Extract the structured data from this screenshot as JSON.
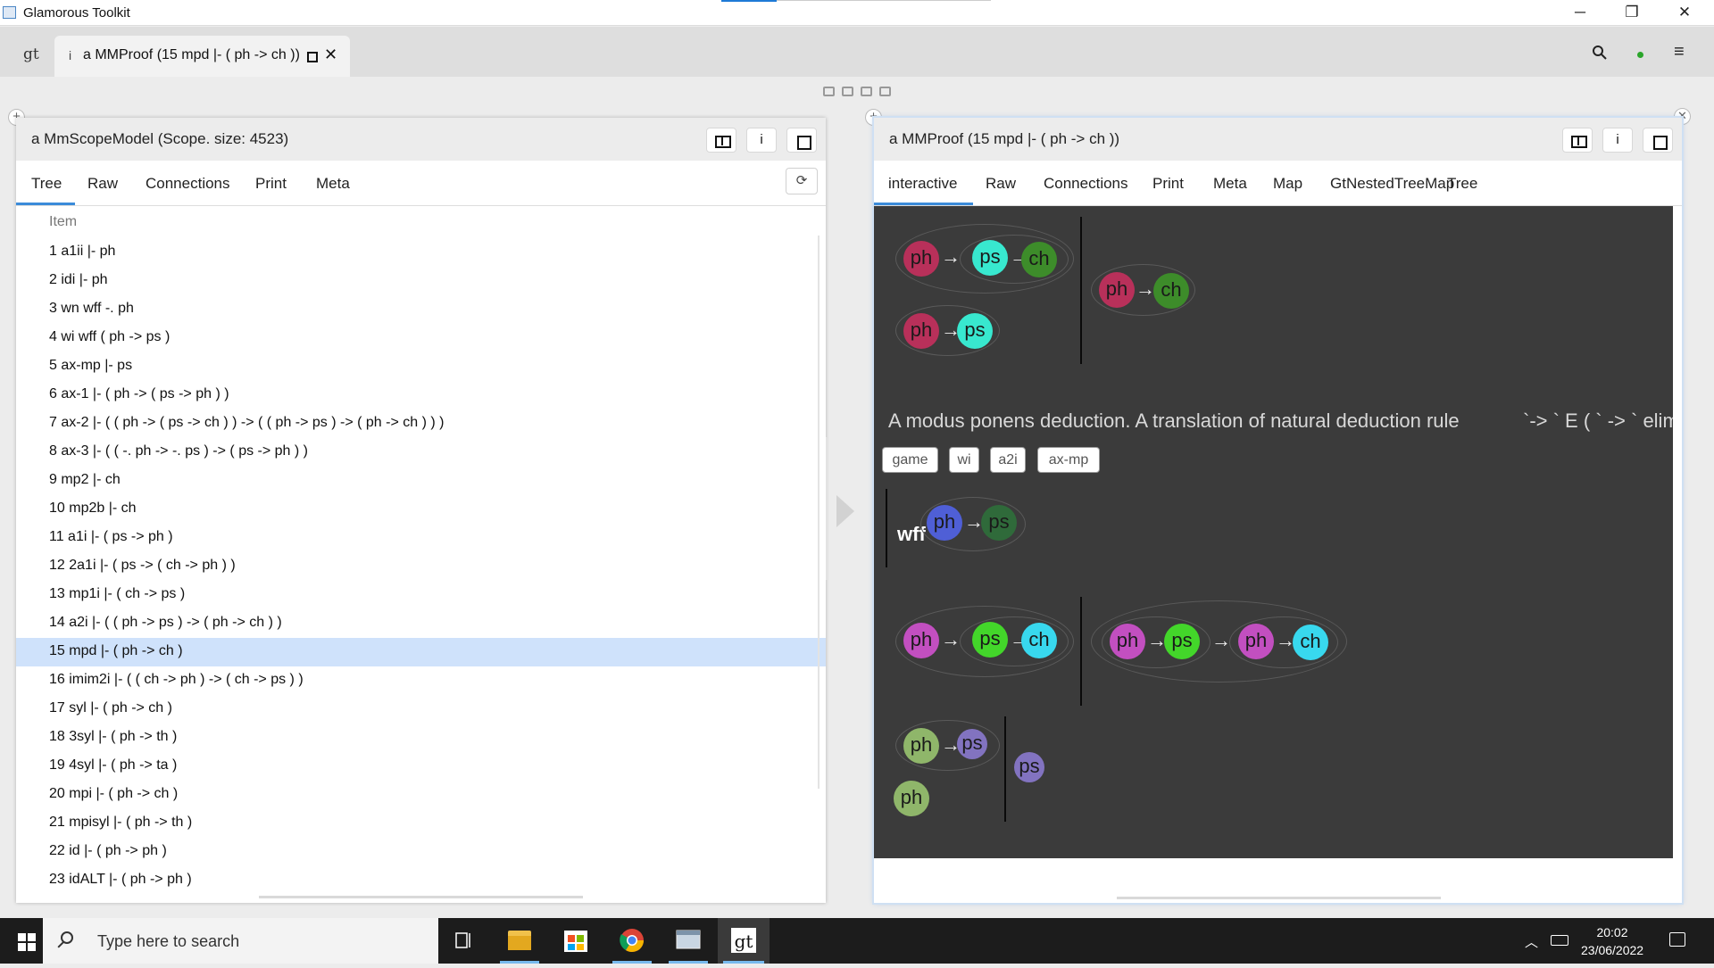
{
  "window": {
    "title": "Glamorous Toolkit",
    "minimize": "─",
    "restore": "❐",
    "close": "✕"
  },
  "tabbar": {
    "logo": "gt",
    "tab": {
      "info_icon": "i",
      "label": "a MMProof (15 mpd |- ( ph -> ch ))",
      "close": "✕"
    },
    "search_icon": "search-icon",
    "status_dot": "#2aa52a",
    "menu_icon": "≡"
  },
  "left_pane": {
    "title": "a MmScopeModel (Scope. size: 4523)",
    "buttons": {
      "inspect": "",
      "info": "i",
      "maximize": ""
    },
    "tabs": [
      "Tree",
      "Raw",
      "Connections",
      "Print",
      "Meta"
    ],
    "active_tab": "Tree",
    "refresh": "⟳",
    "column_header": "Item",
    "rows": [
      "1 a1ii |- ph",
      "2 idi |- ph",
      "3 wn wff -. ph",
      "4 wi wff ( ph -> ps )",
      "5 ax-mp |- ps",
      "6 ax-1 |- ( ph -> ( ps -> ph ) )",
      "7 ax-2 |- ( ( ph -> ( ps -> ch ) ) -> ( ( ph -> ps ) -> ( ph -> ch ) ) )",
      "8 ax-3 |- ( ( -. ph -> -. ps ) -> ( ps -> ph ) )",
      "9 mp2 |- ch",
      "10 mp2b |- ch",
      "11 a1i |- ( ps -> ph )",
      "12 2a1i |- ( ps -> ( ch -> ph ) )",
      "13 mp1i |- ( ch -> ps )",
      "14 a2i |- ( ( ph -> ps ) -> ( ph -> ch ) )",
      "15 mpd |- ( ph -> ch )",
      "16 imim2i |- ( ( ch -> ph ) -> ( ch -> ps ) )",
      "17 syl |- ( ph -> ch )",
      "18 3syl |- ( ph -> th )",
      "19 4syl |- ( ph -> ta )",
      "20 mpi |- ( ph -> ch )",
      "21 mpisyl |- ( ph -> th )",
      "22 id |- ( ph -> ph )",
      "23 idALT |- ( ph -> ph )"
    ],
    "selected_row": 14
  },
  "right_pane": {
    "title": "a MMProof (15 mpd |- ( ph -> ch ))",
    "buttons": {
      "inspect": "",
      "info": "i",
      "maximize": ""
    },
    "tabs": [
      "interactive",
      "Raw",
      "Connections",
      "Print",
      "Meta",
      "Map",
      "GtNestedTreeMap",
      "Tree"
    ],
    "active_tab": "interactive",
    "arrow": "→",
    "var_ph": "ph",
    "var_ps": "ps",
    "var_ch": "ch",
    "description": "A modus ponens deduction.  A translation of natural deduction rule",
    "description_cont": "`-> ` E ( ` -> ` elim",
    "chips": [
      "game",
      "wi",
      "a2i",
      "ax-mp"
    ],
    "wff_label": "wff",
    "colors": {
      "ph_red": "#b8305a",
      "ps_cyan": "#38e8cf",
      "ch_green": "#3d8c2a",
      "ph_blue": "#4f5fd6",
      "ps_dkgreen": "#2f6a3a",
      "ph_magenta": "#c24fc0",
      "ps_lime": "#43d62a",
      "ch_cyan": "#38d8ee",
      "ph_olive": "#8fb66a",
      "ps_violet": "#8273c0",
      "canvas_bg": "#3b3b3b"
    }
  },
  "taskbar": {
    "search_placeholder": "Type here to search",
    "time": "20:02",
    "date": "23/06/2022"
  }
}
